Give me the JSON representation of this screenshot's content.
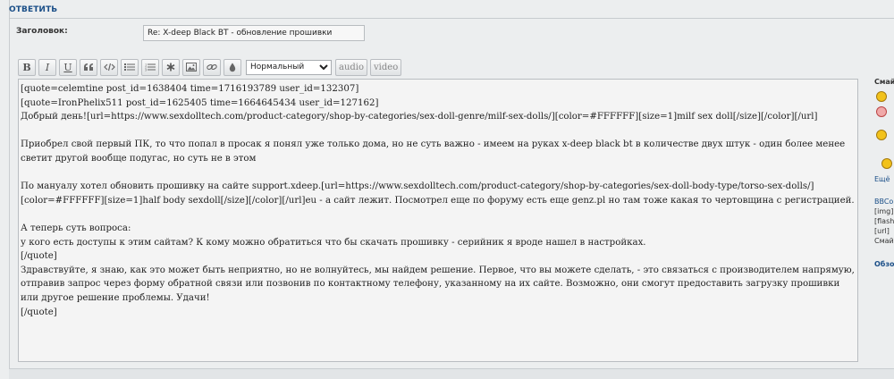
{
  "reply": {
    "title": "ОТВЕТИТЬ"
  },
  "subject": {
    "label": "Заголовок:",
    "value": "Re: X-deep Black BT - обновление прошивки"
  },
  "toolbar": {
    "bold": "B",
    "italic": "I",
    "underline": "U",
    "font_size_selected": "Нормальный",
    "audio": "audio",
    "video": "video"
  },
  "editor": {
    "text": "[quote=celemtine post_id=1638404 time=1716193789 user_id=132307]\n[quote=IronPhelix511 post_id=1625405 time=1664645434 user_id=127162]\nДобрый день![url=https://www.sexdolltech.com/product-category/shop-by-categories/sex-doll-genre/milf-sex-dolls/][color=#FFFFFF][size=1]milf sex doll[/size][/color][/url]\n\nПриобрел свой первый ПК, то что попал в просак я понял уже только дома, но не суть важно - имеем на руках x-deep black bt в количестве двух штук - один более менее светит другой вообще подугас, но суть не в этом\n\nПо мануалу хотел обновить прошивку на сайте support.xdeep.[url=https://www.sexdolltech.com/product-category/shop-by-categories/sex-doll-body-type/torso-sex-dolls/][color=#FFFFFF][size=1]half body sexdoll[/size][/color][/url]eu - а сайт лежит. Посмотрел еще по форуму есть еще genz.pl но там тоже какая то чертовщина с регистрацией.\n\nА теперь суть вопроса:\nу кого есть доступы к этим сайтам? К кому можно обратиться что бы скачать прошивку - серийник я вроде нашел в настройках.\n[/quote]\nЗдравствуйте, я знаю, как это может быть неприятно, но не волнуйтесь, мы найдем решение. Первое, что вы можете сделать, - это связаться с производителем напрямую, отправив запрос через форму обратной связи или позвонив по контактному телефону, указанному на их сайте. Возможно, они смогут предоставить загрузку прошивки или другое решение проблемы. Удачи!\n[/quote]"
  },
  "sidebar": {
    "title": "Смай",
    "more": "Ещё",
    "bbcode_items": [
      "BBCo",
      "[img]",
      "[flash",
      "[url] ",
      "Смай"
    ],
    "review": "Обзо"
  },
  "colors": {
    "accent": "#1b4f88",
    "background": "#eceeef",
    "editor_bg": "#f4f4f4",
    "smiley": "#f2c21b"
  }
}
